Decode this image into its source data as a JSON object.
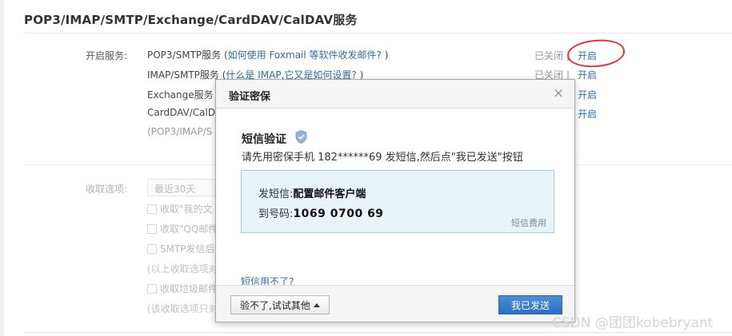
{
  "section": {
    "title": "POP3/IMAP/SMTP/Exchange/CardDAV/CalDAV服务"
  },
  "services": {
    "label": "开启服务:",
    "rows": [
      {
        "name": "POP3/SMTP服务 (",
        "help": "如何使用 Foxmail 等软件收发邮件?",
        "close": " )",
        "state": "已关闭",
        "sep": "|",
        "action": "开启"
      },
      {
        "name": "IMAP/SMTP服务 (",
        "help": "什么是 IMAP,它又是如何设置?",
        "close": " )",
        "state": "已关闭",
        "sep": "|",
        "action": "开启"
      },
      {
        "name": "Exchange服务",
        "action": "开启"
      },
      {
        "name": "CardDAV/CalD",
        "action": "开启"
      }
    ],
    "note": "(POP3/IMAP/S"
  },
  "receive": {
    "label": "收取选项:",
    "select_value": "最近30天",
    "options": [
      "收取\"我的文",
      "收取\"QQ邮件",
      "SMTP发信后",
      "(以上收取选项对",
      "收取垃圾邮件",
      "(该收取选项只对"
    ]
  },
  "dialog": {
    "title": "验证密保",
    "close": "×",
    "sms_title": "短信验证",
    "instruction": "请先用密保手机 182******69 发短信,然后点\"我已发送\"按钮",
    "send_label": "发短信:",
    "send_content": "配置邮件客户端",
    "to_label": "到号码:",
    "to_number": "1069 0700 69",
    "fee_link": "短信费用",
    "cant_use": "短信用不了?",
    "alt_button": "验不了,试试其他",
    "send_button": "我已发送"
  },
  "watermark": "CSDN @团团kobebryant",
  "colors": {
    "link": "#2c6eb3",
    "primary_button": "#2d6fc0",
    "info_box_bg": "#e9f4f9",
    "annotation_red": "#e8323c"
  },
  "icons": {
    "shield": "shield-icon",
    "close": "close-icon",
    "dropdown": "triangle-up-icon"
  }
}
